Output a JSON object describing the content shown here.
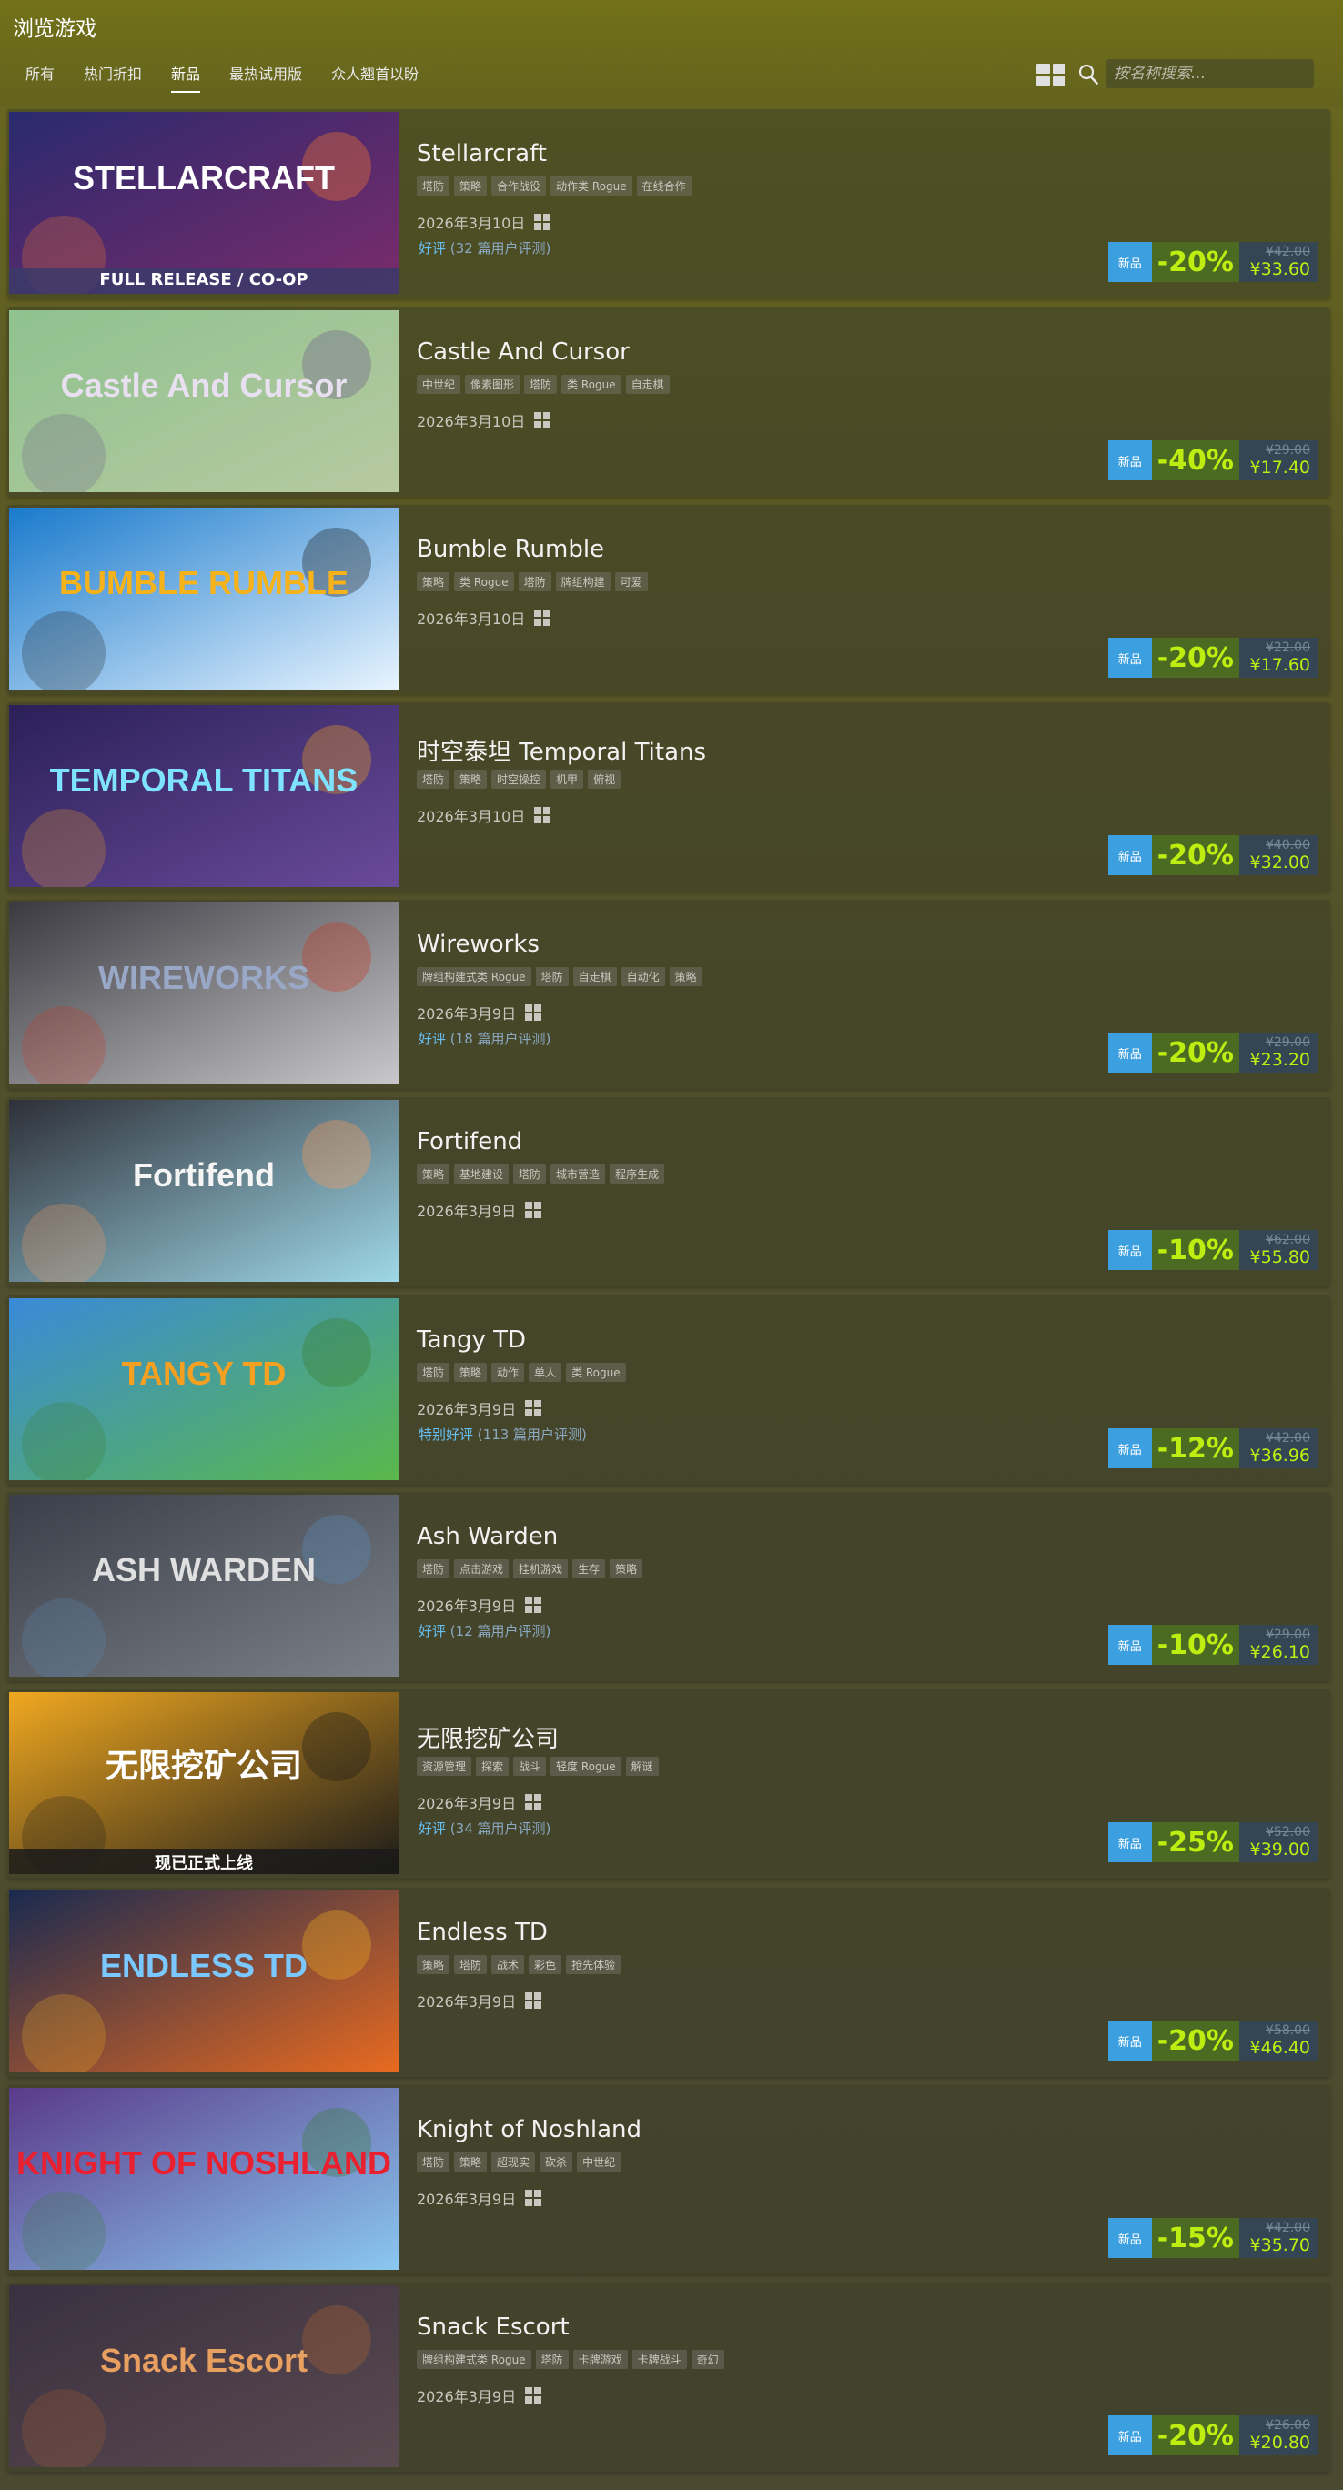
{
  "header": {
    "title": "浏览游戏",
    "tabs": [
      {
        "label": "所有"
      },
      {
        "label": "热门折扣"
      },
      {
        "label": "新品",
        "active": true
      },
      {
        "label": "最热试用版"
      },
      {
        "label": "众人翘首以盼"
      }
    ],
    "search_placeholder": "按名称搜索...",
    "view_toggle_icon": "grid-view-icon",
    "search_icon": "search-icon"
  },
  "colors": {
    "accent_blue": "#3b9fe0",
    "discount_bg": "#4c6b22",
    "discount_text": "#beee11",
    "review_positive": "#66c0f4"
  },
  "games": [
    {
      "name": "Stellarcraft",
      "capsule_text": "STELLARCRAFT",
      "capsule_subtext": "FULL RELEASE / CO-OP",
      "tags": [
        "塔防",
        "策略",
        "合作战役",
        "动作类 Rogue",
        "在线合作"
      ],
      "release_date": "2026年3月10日",
      "review_rating": "好评",
      "review_count": "(32 篇用户评测)",
      "new_label": "新品",
      "discount": "-20%",
      "original_price": "¥42.00",
      "final_price": "¥33.60"
    },
    {
      "name": "Castle And Cursor",
      "capsule_text": "Castle And Cursor",
      "tags": [
        "中世纪",
        "像素图形",
        "塔防",
        "类 Rogue",
        "自走棋"
      ],
      "release_date": "2026年3月10日",
      "review_rating": "",
      "review_count": "",
      "new_label": "新品",
      "discount": "-40%",
      "original_price": "¥29.00",
      "final_price": "¥17.40"
    },
    {
      "name": "Bumble Rumble",
      "capsule_text": "BUMBLE RUMBLE",
      "tags": [
        "策略",
        "类 Rogue",
        "塔防",
        "牌组构建",
        "可爱"
      ],
      "release_date": "2026年3月10日",
      "review_rating": "",
      "review_count": "",
      "new_label": "新品",
      "discount": "-20%",
      "original_price": "¥22.00",
      "final_price": "¥17.60"
    },
    {
      "name": "时空泰坦 Temporal Titans",
      "capsule_text": "TEMPORAL TITANS",
      "tags": [
        "塔防",
        "策略",
        "时空操控",
        "机甲",
        "俯视"
      ],
      "release_date": "2026年3月10日",
      "review_rating": "",
      "review_count": "",
      "new_label": "新品",
      "discount": "-20%",
      "original_price": "¥40.00",
      "final_price": "¥32.00"
    },
    {
      "name": "Wireworks",
      "capsule_text": "WIREWORKS",
      "tags": [
        "牌组构建式类 Rogue",
        "塔防",
        "自走棋",
        "自动化",
        "策略"
      ],
      "release_date": "2026年3月9日",
      "review_rating": "好评",
      "review_count": "(18 篇用户评测)",
      "new_label": "新品",
      "discount": "-20%",
      "original_price": "¥29.00",
      "final_price": "¥23.20"
    },
    {
      "name": "Fortifend",
      "capsule_text": "Fortifend",
      "tags": [
        "策略",
        "基地建设",
        "塔防",
        "城市营造",
        "程序生成"
      ],
      "release_date": "2026年3月9日",
      "review_rating": "",
      "review_count": "",
      "new_label": "新品",
      "discount": "-10%",
      "original_price": "¥62.00",
      "final_price": "¥55.80"
    },
    {
      "name": "Tangy TD",
      "capsule_text": "TANGY TD",
      "tags": [
        "塔防",
        "策略",
        "动作",
        "单人",
        "类 Rogue"
      ],
      "release_date": "2026年3月9日",
      "review_rating": "特别好评",
      "review_count": "(113 篇用户评测)",
      "new_label": "新品",
      "discount": "-12%",
      "original_price": "¥42.00",
      "final_price": "¥36.96"
    },
    {
      "name": "Ash Warden",
      "capsule_text": "ASH WARDEN",
      "tags": [
        "塔防",
        "点击游戏",
        "挂机游戏",
        "生存",
        "策略"
      ],
      "release_date": "2026年3月9日",
      "review_rating": "好评",
      "review_count": "(12 篇用户评测)",
      "new_label": "新品",
      "discount": "-10%",
      "original_price": "¥29.00",
      "final_price": "¥26.10"
    },
    {
      "name": "无限挖矿公司",
      "capsule_text": "无限挖矿公司",
      "capsule_subtext": "现已正式上线",
      "tags": [
        "资源管理",
        "探索",
        "战斗",
        "轻度 Rogue",
        "解谜"
      ],
      "release_date": "2026年3月9日",
      "review_rating": "好评",
      "review_count": "(34 篇用户评测)",
      "new_label": "新品",
      "discount": "-25%",
      "original_price": "¥52.00",
      "final_price": "¥39.00"
    },
    {
      "name": "Endless TD",
      "capsule_text": "ENDLESS TD",
      "tags": [
        "策略",
        "塔防",
        "战术",
        "彩色",
        "抢先体验"
      ],
      "release_date": "2026年3月9日",
      "review_rating": "",
      "review_count": "",
      "new_label": "新品",
      "discount": "-20%",
      "original_price": "¥58.00",
      "final_price": "¥46.40"
    },
    {
      "name": "Knight of Noshland",
      "capsule_text": "KNIGHT OF NOSHLAND",
      "tags": [
        "塔防",
        "策略",
        "超现实",
        "砍杀",
        "中世纪"
      ],
      "release_date": "2026年3月9日",
      "review_rating": "",
      "review_count": "",
      "new_label": "新品",
      "discount": "-15%",
      "original_price": "¥42.00",
      "final_price": "¥35.70"
    },
    {
      "name": "Snack Escort",
      "capsule_text": "Snack Escort",
      "tags": [
        "牌组构建式类 Rogue",
        "塔防",
        "卡牌游戏",
        "卡牌战斗",
        "奇幻"
      ],
      "release_date": "2026年3月9日",
      "review_rating": "",
      "review_count": "",
      "new_label": "新品",
      "discount": "-20%",
      "original_price": "¥26.00",
      "final_price": "¥20.80"
    }
  ]
}
